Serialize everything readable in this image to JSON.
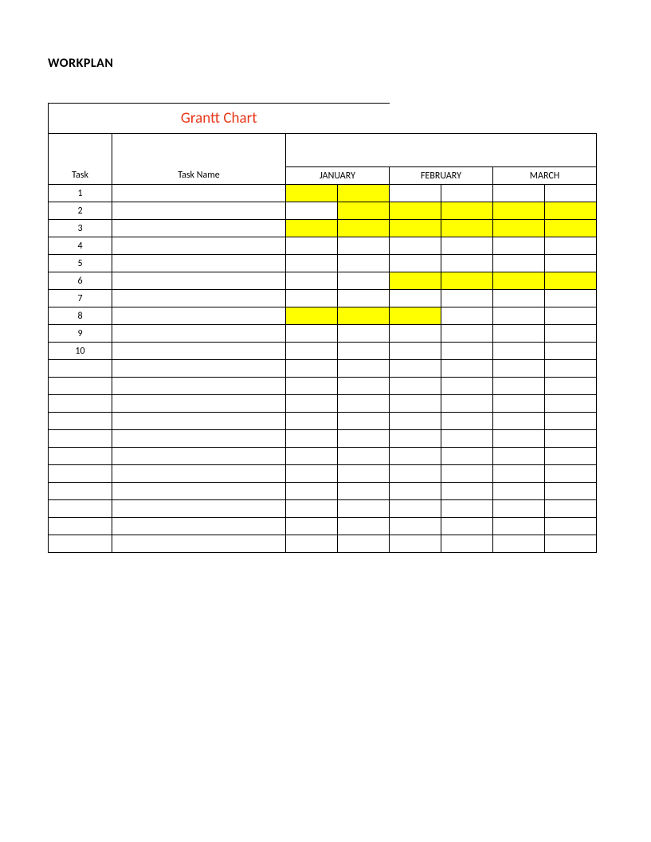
{
  "doc_title": "WORKPLAN",
  "chart_title": "Grantt Chart",
  "headers": {
    "task": "Task",
    "task_name": "Task Name",
    "months": [
      "JANUARY",
      "FEBRUARY",
      "MARCH"
    ]
  },
  "task_numbers": [
    "1",
    "2",
    "3",
    "4",
    "5",
    "6",
    "7",
    "8",
    "9",
    "10"
  ],
  "empty_rows_after": 11,
  "chart_data": {
    "type": "table",
    "title": "Grantt Chart",
    "columns_months": [
      "JANUARY-1",
      "JANUARY-2",
      "FEBRUARY-1",
      "FEBRUARY-2",
      "MARCH-1",
      "MARCH-2"
    ],
    "rows": [
      {
        "task": 1,
        "cells": [
          true,
          true,
          false,
          false,
          false,
          false
        ]
      },
      {
        "task": 2,
        "cells": [
          false,
          true,
          true,
          true,
          true,
          true
        ]
      },
      {
        "task": 3,
        "cells": [
          true,
          true,
          true,
          true,
          true,
          true
        ]
      },
      {
        "task": 4,
        "cells": [
          false,
          false,
          false,
          false,
          false,
          false
        ]
      },
      {
        "task": 5,
        "cells": [
          false,
          false,
          false,
          false,
          false,
          false
        ]
      },
      {
        "task": 6,
        "cells": [
          false,
          false,
          true,
          true,
          true,
          true
        ]
      },
      {
        "task": 7,
        "cells": [
          false,
          false,
          false,
          false,
          false,
          false
        ]
      },
      {
        "task": 8,
        "cells": [
          true,
          true,
          true,
          false,
          false,
          false
        ]
      },
      {
        "task": 9,
        "cells": [
          false,
          false,
          false,
          false,
          false,
          false
        ]
      },
      {
        "task": 10,
        "cells": [
          false,
          false,
          false,
          false,
          false,
          false
        ]
      }
    ]
  },
  "colors": {
    "highlight": "#ffff00",
    "title_color": "#e8371a"
  }
}
